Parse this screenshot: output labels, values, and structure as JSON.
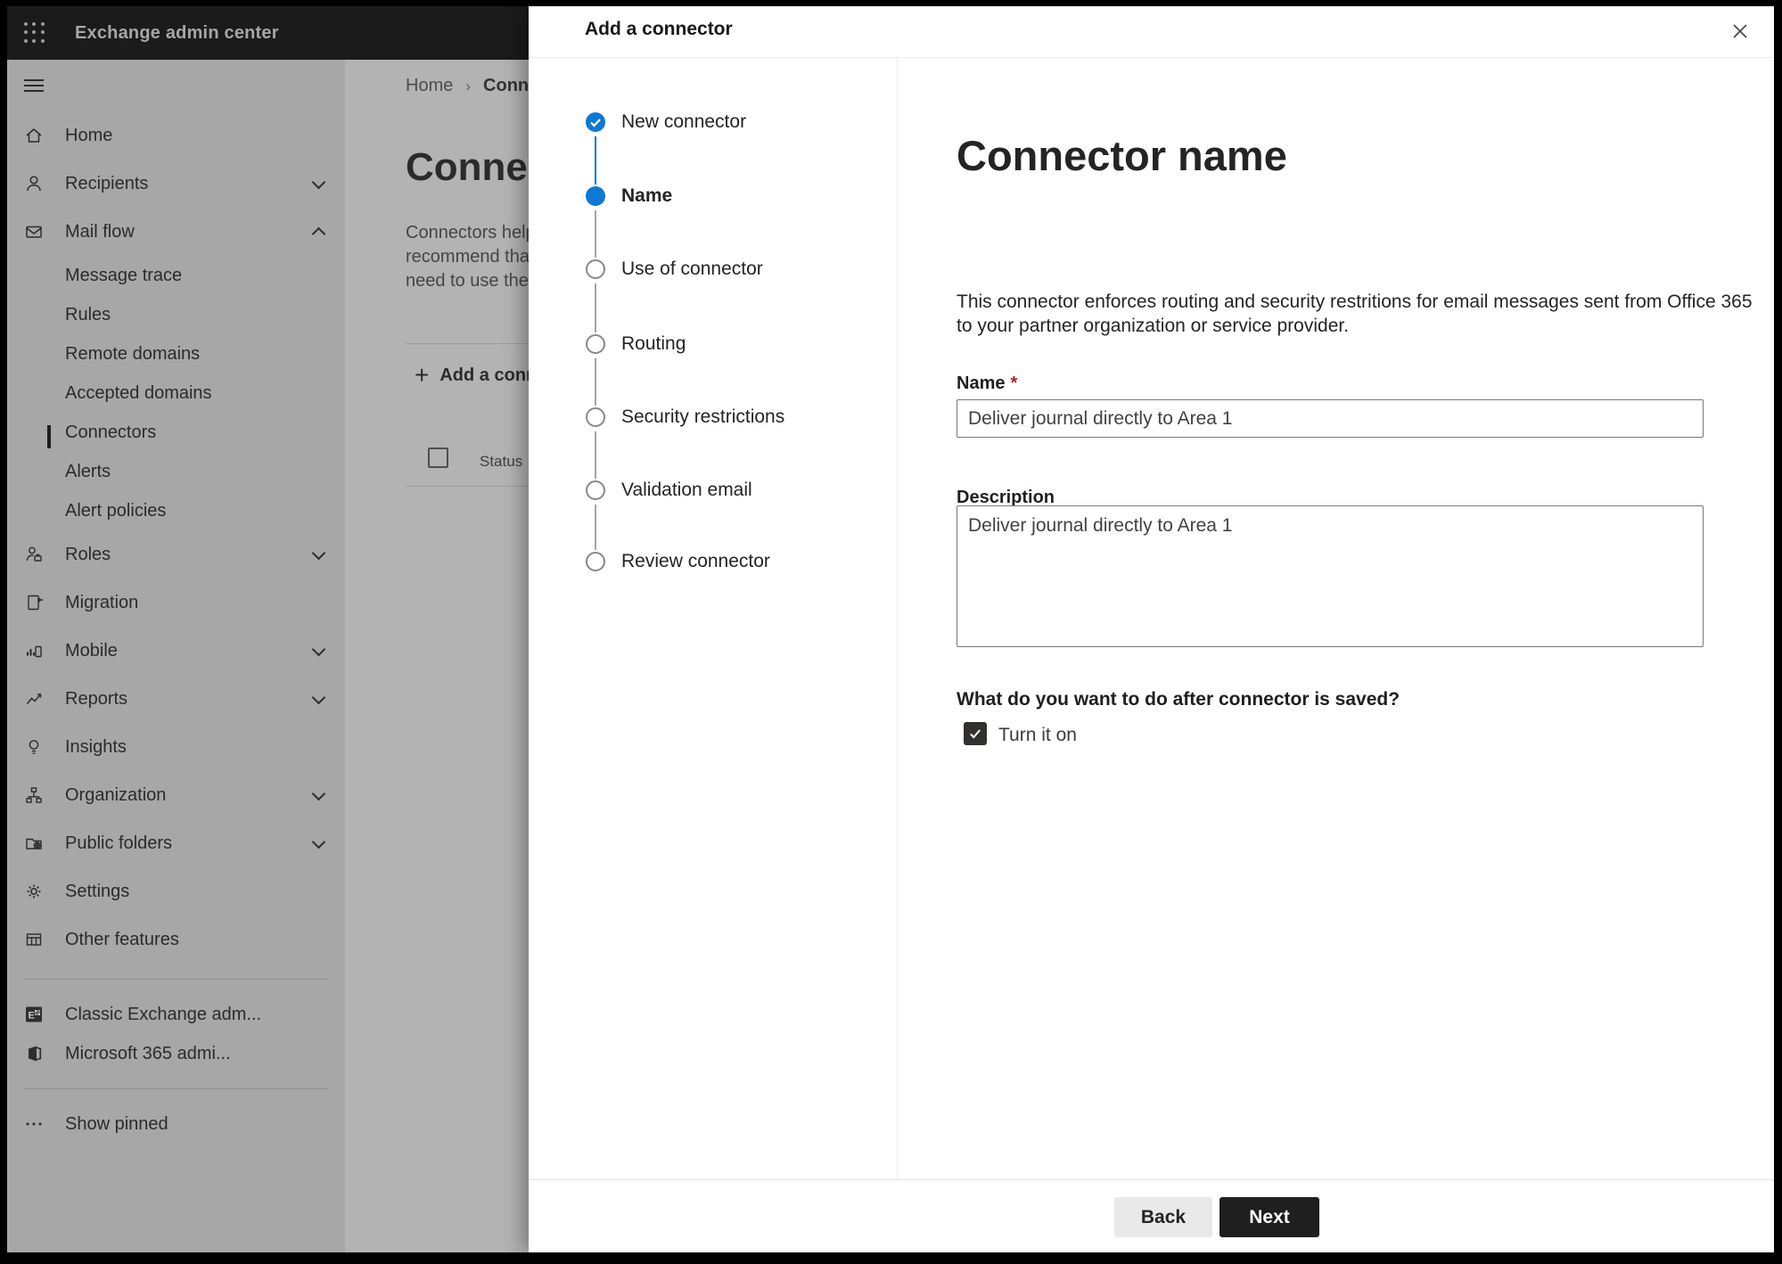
{
  "topbar": {
    "title": "Exchange admin center"
  },
  "sidebar": {
    "items": [
      {
        "label": "Home"
      },
      {
        "label": "Recipients"
      },
      {
        "label": "Mail flow"
      },
      {
        "label": "Message trace"
      },
      {
        "label": "Rules"
      },
      {
        "label": "Remote domains"
      },
      {
        "label": "Accepted domains"
      },
      {
        "label": "Connectors"
      },
      {
        "label": "Alerts"
      },
      {
        "label": "Alert policies"
      },
      {
        "label": "Roles"
      },
      {
        "label": "Migration"
      },
      {
        "label": "Mobile"
      },
      {
        "label": "Reports"
      },
      {
        "label": "Insights"
      },
      {
        "label": "Organization"
      },
      {
        "label": "Public folders"
      },
      {
        "label": "Settings"
      },
      {
        "label": "Other features"
      },
      {
        "label": "Classic Exchange adm..."
      },
      {
        "label": "Microsoft 365 admi..."
      },
      {
        "label": "Show pinned"
      }
    ]
  },
  "page": {
    "breadcrumb": {
      "home": "Home",
      "separator": "›",
      "current": "Conne"
    },
    "title": "Connect",
    "body_lines": [
      "Connectors help",
      "recommend that",
      "need to use ther"
    ],
    "add_button_label": "Add a conn",
    "add_button_plus": "+",
    "status_header": "Status"
  },
  "modal": {
    "title": "Add a connector",
    "steps": [
      {
        "label": "New connector",
        "state": "completed"
      },
      {
        "label": "Name",
        "state": "current"
      },
      {
        "label": "Use of connector",
        "state": "upcoming"
      },
      {
        "label": "Routing",
        "state": "upcoming"
      },
      {
        "label": "Security restrictions",
        "state": "upcoming"
      },
      {
        "label": "Validation email",
        "state": "upcoming"
      },
      {
        "label": "Review connector",
        "state": "upcoming"
      }
    ],
    "content": {
      "heading": "Connector name",
      "description_lines": [
        "This connector enforces routing and security restritions for email messages sent from Office 365",
        "to your partner organization or service provider."
      ],
      "name_label": "Name",
      "required_marker": "*",
      "name_value": "Deliver journal directly to Area 1",
      "description_label": "Description",
      "description_value": "Deliver journal directly to Area 1",
      "after_save_question": "What do you want to do after connector is saved?",
      "turn_on_label": "Turn it on"
    },
    "footer": {
      "back_label": "Back",
      "next_label": "Next"
    }
  },
  "colors": {
    "accent_blue": "#0f78d4",
    "topbar_bg": "#1b1b1b",
    "next_button_bg": "#1f1f1f",
    "required_red": "#a4262c",
    "checkbox_checked_bg": "#323130"
  }
}
